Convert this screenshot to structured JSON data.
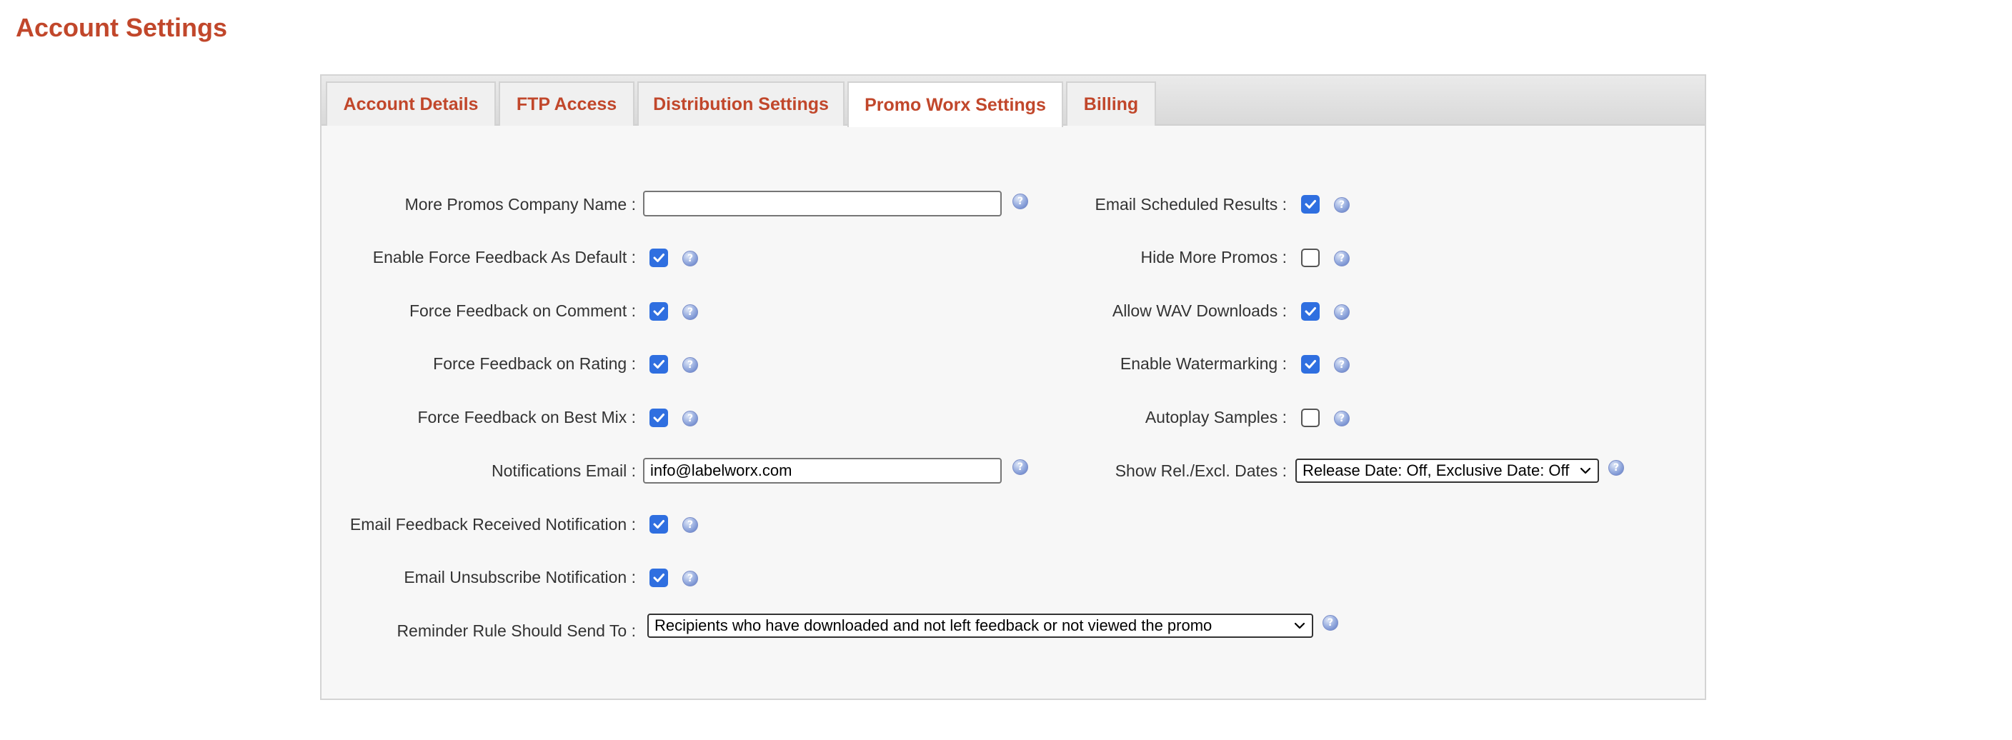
{
  "page": {
    "title": "Account Settings"
  },
  "tabs": [
    {
      "label": "Account Details"
    },
    {
      "label": "FTP Access"
    },
    {
      "label": "Distribution Settings"
    },
    {
      "label": "Promo Worx Settings",
      "active": true
    },
    {
      "label": "Billing"
    }
  ],
  "form": {
    "company_name": {
      "label": "More Promos Company Name :",
      "value": ""
    },
    "force_feedback_default": {
      "label": "Enable Force Feedback As Default :",
      "checked": true
    },
    "force_feedback_comment": {
      "label": "Force Feedback on Comment :",
      "checked": true
    },
    "force_feedback_rating": {
      "label": "Force Feedback on Rating :",
      "checked": true
    },
    "force_feedback_best_mix": {
      "label": "Force Feedback on Best Mix :",
      "checked": true
    },
    "notifications_email": {
      "label": "Notifications Email :",
      "value": "info@labelworx.com"
    },
    "email_feedback_received": {
      "label": "Email Feedback Received Notification :",
      "checked": true
    },
    "email_unsubscribe": {
      "label": "Email Unsubscribe Notification :",
      "checked": true
    },
    "reminder_rule": {
      "label": "Reminder Rule Should Send To :",
      "value": "Recipients who have downloaded and not left feedback or not viewed the promo"
    },
    "email_scheduled_results": {
      "label": "Email Scheduled Results :",
      "checked": true
    },
    "hide_more_promos": {
      "label": "Hide More Promos :",
      "checked": false
    },
    "allow_wav_downloads": {
      "label": "Allow WAV Downloads :",
      "checked": true
    },
    "enable_watermarking": {
      "label": "Enable Watermarking :",
      "checked": true
    },
    "autoplay_samples": {
      "label": "Autoplay Samples :",
      "checked": false
    },
    "show_rel_excl_dates": {
      "label": "Show Rel./Excl. Dates :",
      "value": "Release Date: Off, Exclusive Date: Off"
    }
  },
  "icons": {
    "help": "help-icon",
    "checkbox": "checkmark-icon",
    "dropdown": "chevron-down-icon"
  },
  "colors": {
    "accent": "#c1472b",
    "checkbox": "#2f6fe0",
    "panel_bg": "#f7f7f7"
  }
}
